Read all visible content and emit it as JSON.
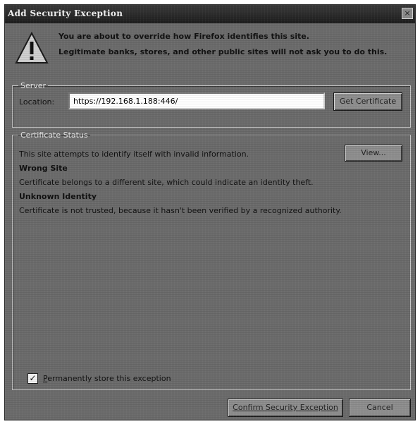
{
  "window": {
    "title": "Add Security Exception",
    "close_glyph": "×"
  },
  "warning": {
    "icon": "warning-triangle-icon",
    "line1": "You are about to override how Firefox identifies this site.",
    "line2": "Legitimate banks, stores, and other public sites will not ask you to do this."
  },
  "server": {
    "legend": "Server",
    "location_label": "Location:",
    "location_value": "https://192.168.1.188:446/",
    "get_certificate_label": "Get Certificate"
  },
  "certificate_status": {
    "legend": "Certificate Status",
    "summary": "This site attempts to identify itself with invalid information.",
    "view_label": "View...",
    "issues": [
      {
        "heading": "Wrong Site",
        "detail": "Certificate belongs to a different site, which could indicate an identity theft."
      },
      {
        "heading": "Unknown Identity",
        "detail": "Certificate is not trusted, because it hasn't been verified by a recognized authority."
      }
    ]
  },
  "store": {
    "checked": true,
    "check_glyph": "✓",
    "label_underlined": "P",
    "label_rest": "ermanently store this exception"
  },
  "footer": {
    "confirm_label": "Confirm Security Exception",
    "cancel_label": "Cancel"
  },
  "colors": {
    "dialog_background": "#6b6b6b",
    "titlebar": "#1e1e1e",
    "input_background": "#ffffff"
  }
}
